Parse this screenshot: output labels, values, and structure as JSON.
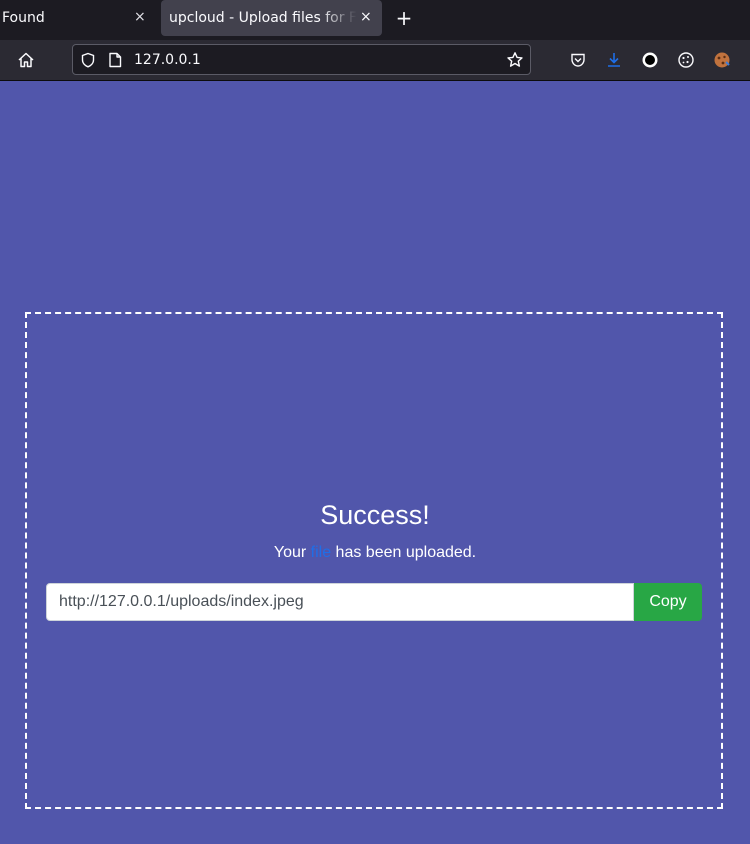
{
  "browser": {
    "tabs": [
      {
        "label": "Found",
        "close": "×"
      },
      {
        "label": "upcloud - Upload files for Free!",
        "close": "×"
      }
    ],
    "new_tab": "+",
    "address": "127.0.0.1",
    "accent_color": "#1e6ee8"
  },
  "page": {
    "background_color": "#5156ab",
    "title": "Success!",
    "message_before": "Your ",
    "message_link": "file",
    "message_after": " has been uploaded.",
    "upload_url": "http://127.0.0.1/uploads/index.jpeg",
    "copy_label": "Copy",
    "copy_color": "#28a745"
  }
}
